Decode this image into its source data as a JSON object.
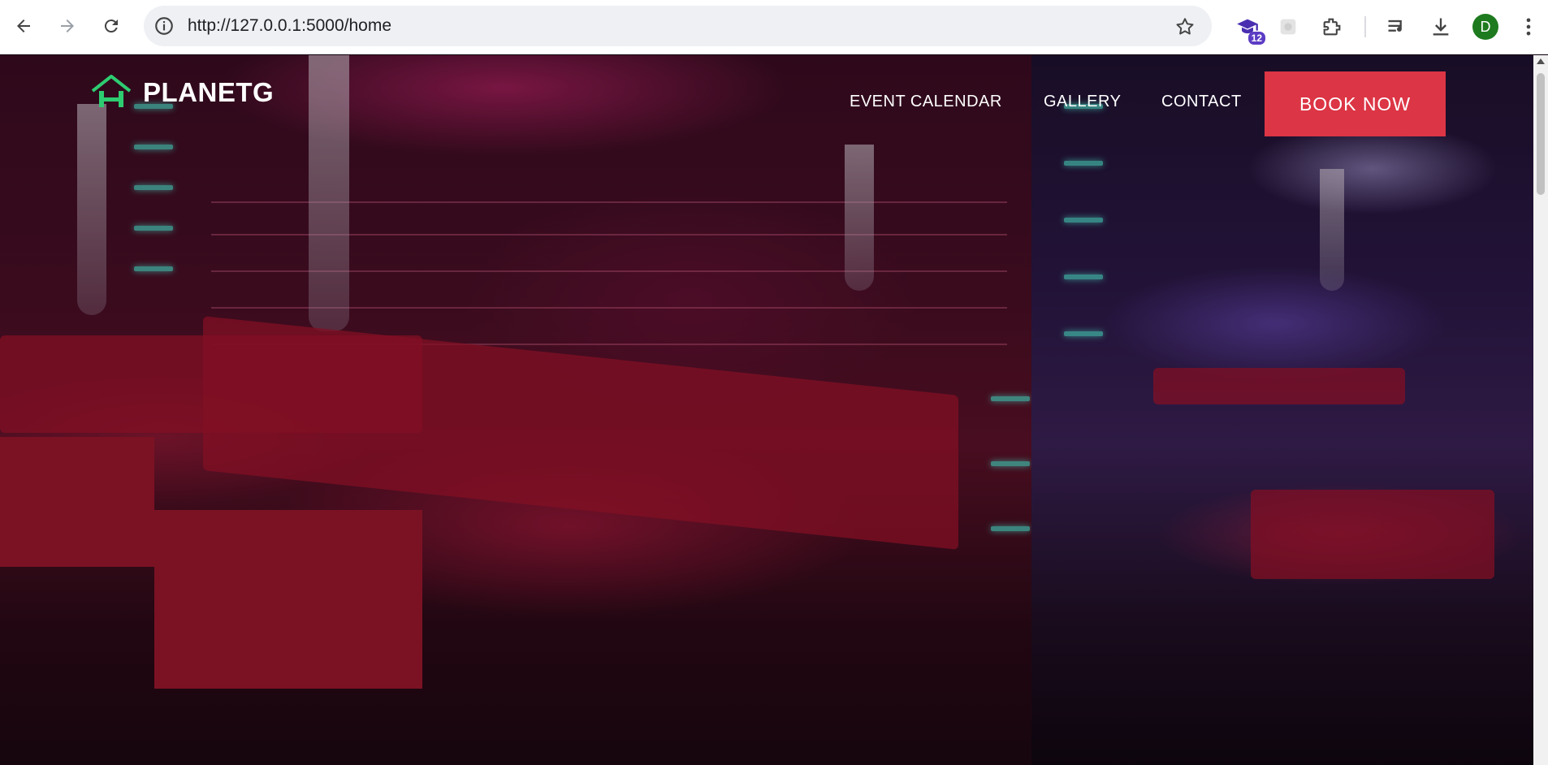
{
  "browser": {
    "url": "http://127.0.0.1:5000/home",
    "extension_badge": "12",
    "profile_initial": "D",
    "icons": [
      "back-icon",
      "forward-icon",
      "reload-icon",
      "site-info-icon",
      "bookmark-star-icon",
      "graduation-cap-extension-icon",
      "puzzle-extension-icon",
      "extensions-icon",
      "media-control-icon",
      "download-icon",
      "kebab-menu-icon"
    ]
  },
  "site": {
    "brand": "PLANETG",
    "nav": {
      "event_calendar": "EVENT CALENDAR",
      "gallery": "GALLERY",
      "contact": "CONTACT"
    },
    "cta": "BOOK NOW"
  },
  "colors": {
    "cta": "#dc3545",
    "logo_green": "#2ecc71",
    "text": "#ffffff"
  }
}
